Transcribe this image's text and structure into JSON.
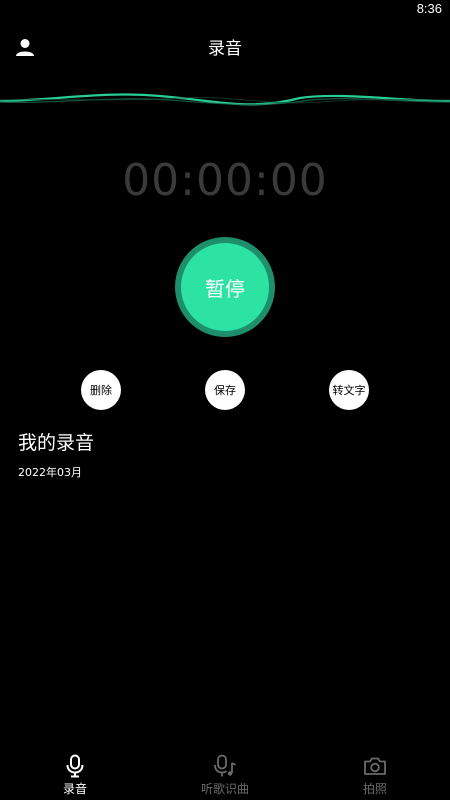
{
  "status": {
    "time": "8:36"
  },
  "header": {
    "title": "录音",
    "user_icon": "user-icon"
  },
  "timer": {
    "value": "00:00:00"
  },
  "main_button": {
    "label": "暂停"
  },
  "actions": [
    {
      "label": "删除"
    },
    {
      "label": "保存"
    },
    {
      "label": "转文字"
    }
  ],
  "recordings": {
    "title": "我的录音",
    "month": "2022年03月"
  },
  "tabs": [
    {
      "label": "录音",
      "icon": "microphone-icon",
      "active": true
    },
    {
      "label": "听歌识曲",
      "icon": "music-mic-icon",
      "active": false
    },
    {
      "label": "拍照",
      "icon": "camera-icon",
      "active": false
    }
  ],
  "colors": {
    "accent": "#2de3a4",
    "accent_dark": "#1d8f6a",
    "wave": "#2de3a4",
    "timer": "#3a3a3a",
    "inactive": "#6b6b6b"
  }
}
